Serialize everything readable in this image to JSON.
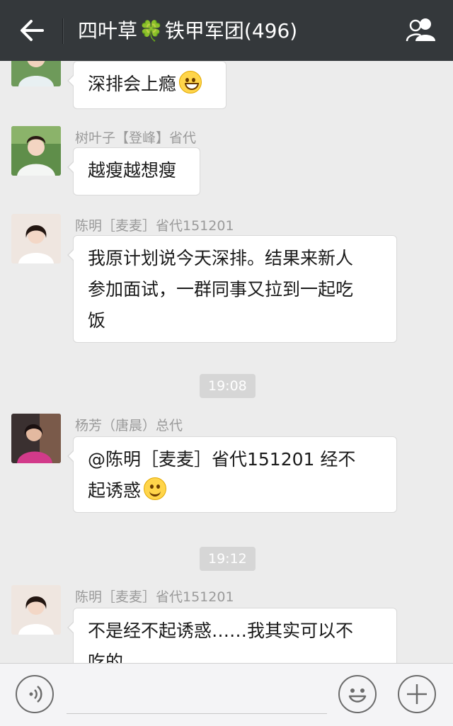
{
  "header": {
    "back_icon": "arrow-left-icon",
    "title_part1": "四叶草",
    "title_clover": "🍀",
    "title_part2": "铁甲军团(496)",
    "group_icon": "group-members-icon"
  },
  "messages": [
    {
      "sender": "",
      "text": "深排会上瘾",
      "emoji": "grinning-face"
    },
    {
      "sender": "树叶子【登峰】省代",
      "text": "越瘦越想瘦"
    },
    {
      "sender": "陈明［麦麦］省代151201",
      "lines": [
        "我原计划说今天深排。结果来新人",
        "参加面试，一群同事又拉到一起吃",
        "饭"
      ]
    },
    {
      "timestamp": "19:08"
    },
    {
      "sender": "杨芳（唐晨）总代",
      "lines": [
        "@陈明［麦麦］省代151201 经不",
        "起诱惑"
      ],
      "emoji": "smiling-face"
    },
    {
      "timestamp": "19:12"
    },
    {
      "sender": "陈明［麦麦］省代151201",
      "lines": [
        "不是经不起诱惑……我其实可以不",
        "吃的"
      ]
    }
  ],
  "toolbar": {
    "voice_icon": "voice-input-icon",
    "emoji_icon": "emoji-icon",
    "plus_icon": "plus-icon"
  },
  "colors": {
    "header_bg": "#34383b",
    "chat_bg": "#ececec",
    "bubble_bg": "#ffffff",
    "timestamp_bg": "#d6d6d6"
  }
}
